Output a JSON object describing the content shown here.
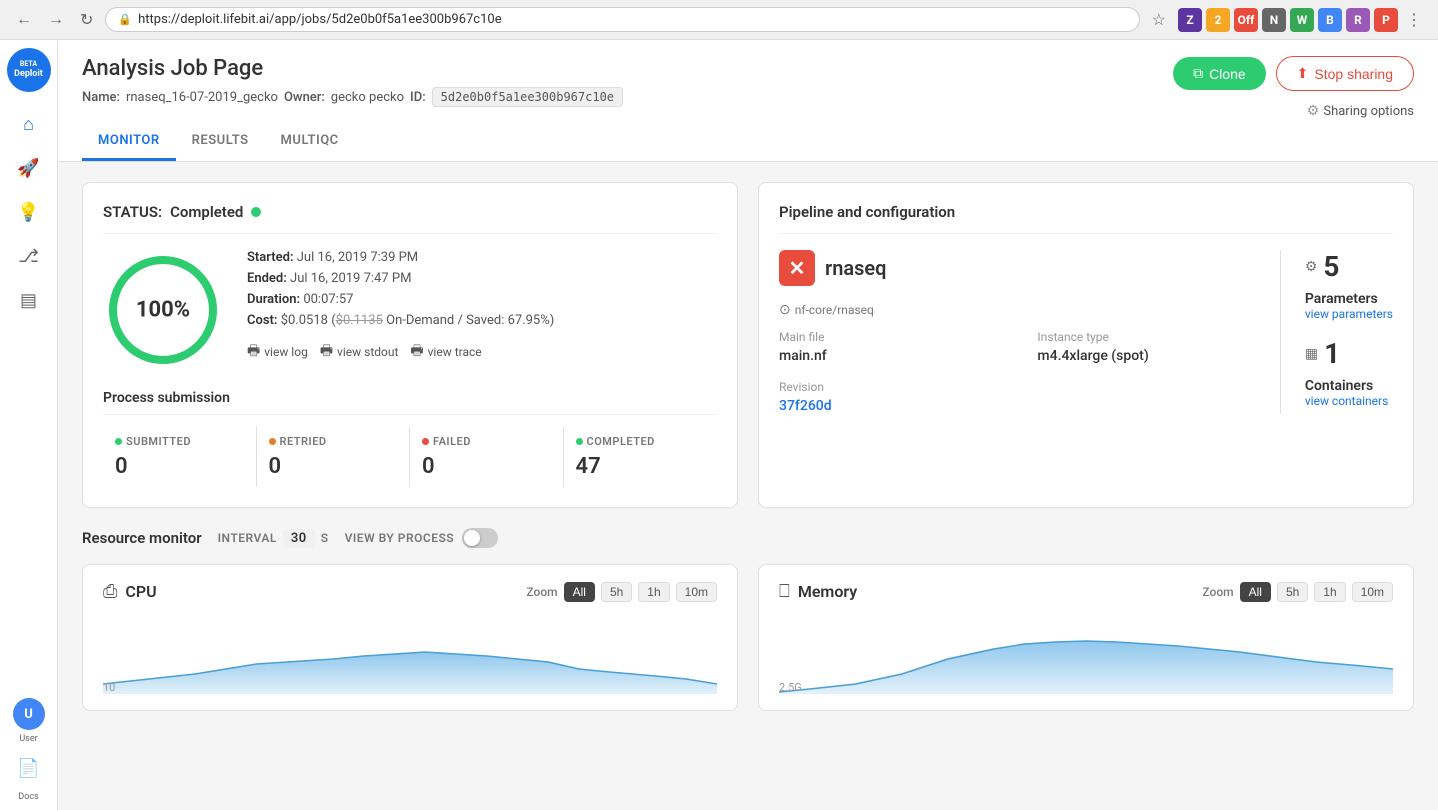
{
  "browser": {
    "url": "https://deploit.lifebit.ai/app/jobs/5d2e0b0f5a1ee300b967c10e",
    "back_disabled": false,
    "forward_disabled": false
  },
  "page": {
    "title": "Analysis Job Page",
    "meta": {
      "name_label": "Name:",
      "name_value": "rnaseq_16-07-2019_gecko",
      "owner_label": "Owner:",
      "owner_value": "gecko pecko",
      "id_label": "ID:",
      "id_value": "5d2e0b0f5a1ee300b967c10e"
    },
    "actions": {
      "clone_label": "Clone",
      "stop_sharing_label": "Stop sharing",
      "sharing_options_label": "Sharing options"
    },
    "tabs": [
      "MONITOR",
      "RESULTS",
      "MULTIQC"
    ],
    "active_tab": "MONITOR"
  },
  "status_card": {
    "title": "STATUS:",
    "status_text": "Completed",
    "progress_percent": 100,
    "progress_label": "100%",
    "started_label": "Started:",
    "started_value": "Jul 16, 2019 7:39 PM",
    "ended_label": "Ended:",
    "ended_value": "Jul 16, 2019 7:47 PM",
    "duration_label": "Duration:",
    "duration_value": "00:07:57",
    "cost_label": "Cost:",
    "cost_value": "$0.0518",
    "cost_original": "$0.1135",
    "cost_suffix": "On-Demand / Saved: 67.95%)",
    "view_log": "view log",
    "view_stdout": "view stdout",
    "view_trace": "view trace"
  },
  "process_submission": {
    "title": "Process submission",
    "submitted": {
      "label": "SUBMITTED",
      "value": "0"
    },
    "retried": {
      "label": "RETRIED",
      "value": "0"
    },
    "failed": {
      "label": "FAILED",
      "value": "0"
    },
    "completed": {
      "label": "COMPLETED",
      "value": "47"
    }
  },
  "pipeline_card": {
    "title": "Pipeline and configuration",
    "pipeline_logo_letter": "✕",
    "pipeline_name": "rnaseq",
    "source": "nf-core/rnaseq",
    "main_file_label": "Main file",
    "main_file_value": "main.nf",
    "revision_label": "Revision",
    "revision_value": "37f260d",
    "instance_type_label": "Instance type",
    "instance_type_value": "m4.4xlarge (spot)",
    "parameters_label": "Parameters",
    "parameters_count": "5",
    "view_parameters": "view parameters",
    "containers_label": "Containers",
    "containers_count": "1",
    "view_containers": "view containers"
  },
  "resource_monitor": {
    "title": "Resource monitor",
    "interval_label": "INTERVAL",
    "interval_value": "30",
    "interval_unit": "S",
    "view_by_process_label": "VIEW BY PROCESS",
    "cpu": {
      "title": "CPU",
      "zoom_label": "Zoom",
      "zoom_options": [
        "All",
        "5h",
        "1h",
        "10m"
      ],
      "active_zoom": "All",
      "y_value": "10"
    },
    "memory": {
      "title": "Memory",
      "zoom_label": "Zoom",
      "zoom_options": [
        "All",
        "5h",
        "1h",
        "10m"
      ],
      "active_zoom": "All",
      "y_value": "2.5G"
    }
  },
  "sidebar": {
    "logo_line1": "BETA",
    "logo_line2": "Deploit",
    "items": [
      {
        "name": "home",
        "icon": "⌂"
      },
      {
        "name": "rocket",
        "icon": "🚀"
      },
      {
        "name": "bulb",
        "icon": "💡"
      },
      {
        "name": "workflow",
        "icon": "⎇"
      },
      {
        "name": "database",
        "icon": "▤"
      }
    ],
    "user_initial": "U",
    "user_label": "User",
    "docs_label": "Docs"
  }
}
